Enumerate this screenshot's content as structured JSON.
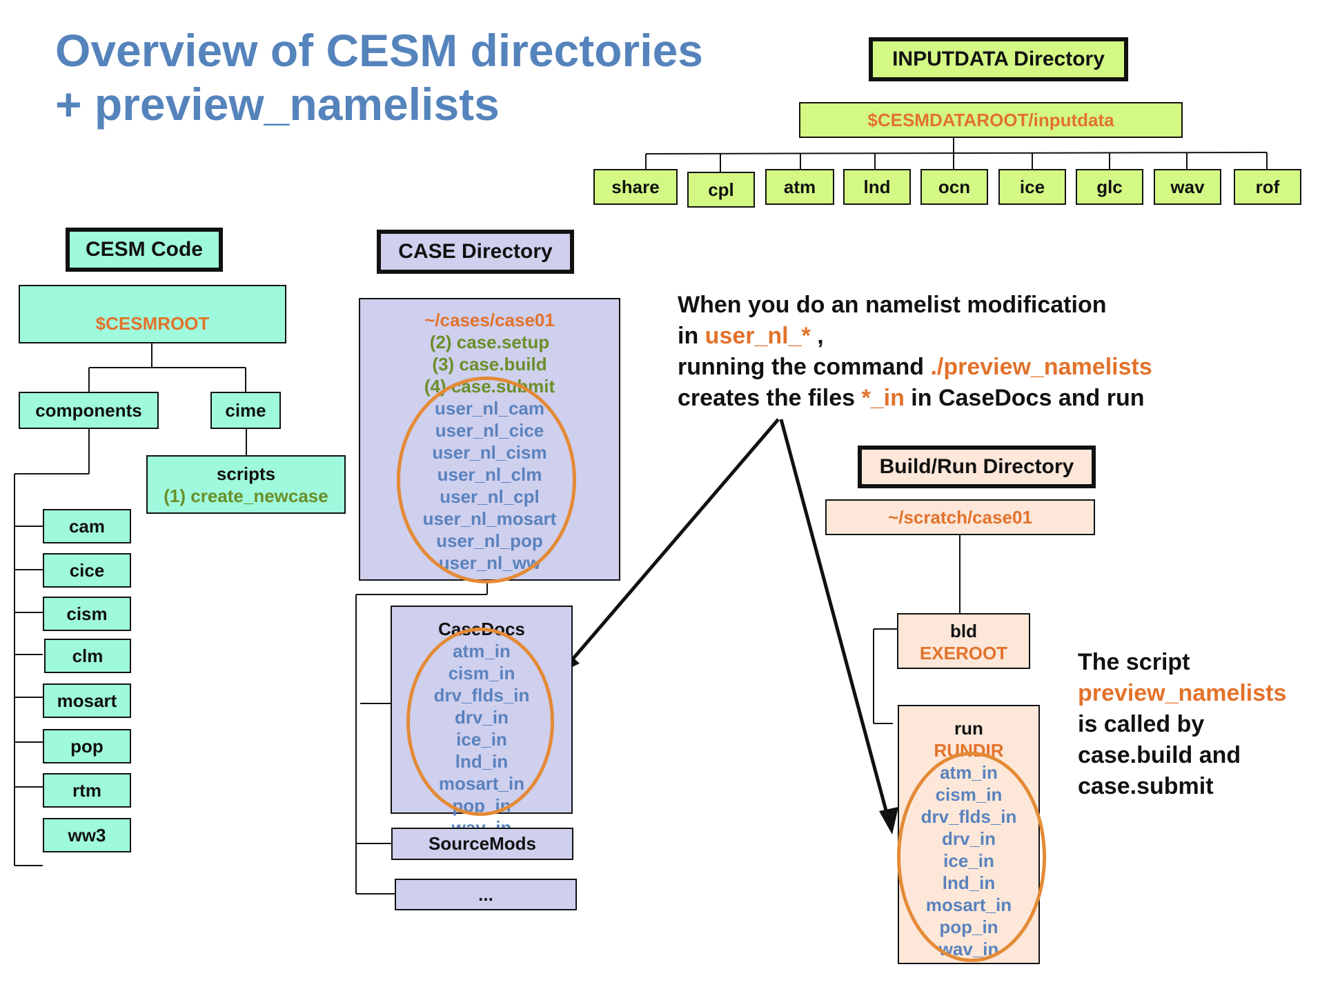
{
  "title": {
    "line1": "Overview of CESM directories",
    "line2": "+ preview_namelists"
  },
  "inputdata": {
    "header": "INPUTDATA Directory",
    "root": "$CESMDATAROOT/inputdata",
    "children": [
      "share",
      "cpl",
      "atm",
      "lnd",
      "ocn",
      "ice",
      "glc",
      "wav",
      "rof"
    ]
  },
  "cesm_code": {
    "header": "CESM Code",
    "root": "$CESMROOT",
    "components": "components",
    "cime": "cime",
    "scripts": "scripts",
    "scripts_step": "(1) create_newcase",
    "component_list": [
      "cam",
      "cice",
      "cism",
      "clm",
      "mosart",
      "pop",
      "rtm",
      "ww3"
    ]
  },
  "case_dir": {
    "header": "CASE Directory",
    "root": "~/cases/case01",
    "steps": [
      "(2) case.setup",
      "(3) case.build",
      "(4) case.submit"
    ],
    "user_nl": [
      "user_nl_cam",
      "user_nl_cice",
      "user_nl_cism",
      "user_nl_clm",
      "user_nl_cpl",
      "user_nl_mosart",
      "user_nl_pop",
      "user_nl_ww"
    ],
    "casedocs": "CaseDocs",
    "casedocs_files": [
      "atm_in",
      "cism_in",
      "drv_flds_in",
      "drv_in",
      "ice_in",
      "lnd_in",
      "mosart_in",
      "pop_in",
      "wav_in"
    ],
    "sourcemods": "SourceMods",
    "more": "..."
  },
  "buildrun": {
    "header": "Build/Run Directory",
    "root": "~/scratch/case01",
    "bld": "bld",
    "bld_var": "EXEROOT",
    "run": "run",
    "run_var": "RUNDIR",
    "run_files": [
      "atm_in",
      "cism_in",
      "drv_flds_in",
      "drv_in",
      "ice_in",
      "lnd_in",
      "mosart_in",
      "pop_in",
      "wav_in"
    ]
  },
  "note1": {
    "l1": "When you do an namelist modification",
    "l2a": "in ",
    "l2b": "user_nl_*",
    "l2c": " ,",
    "l3a": "running the command ",
    "l3b": "./preview_namelists",
    "l4a": "creates the files ",
    "l4b": "*_in",
    "l4c": " in CaseDocs and run"
  },
  "note2": {
    "l1": "The script",
    "l2": "preview_namelists",
    "l3": "is called by",
    "l4": "case.build and",
    "l5": "case.submit"
  },
  "colors": {
    "title": "#5583bc",
    "highlight": "#e2722b",
    "step": "#6a8f2a",
    "file": "#5a82bd"
  }
}
